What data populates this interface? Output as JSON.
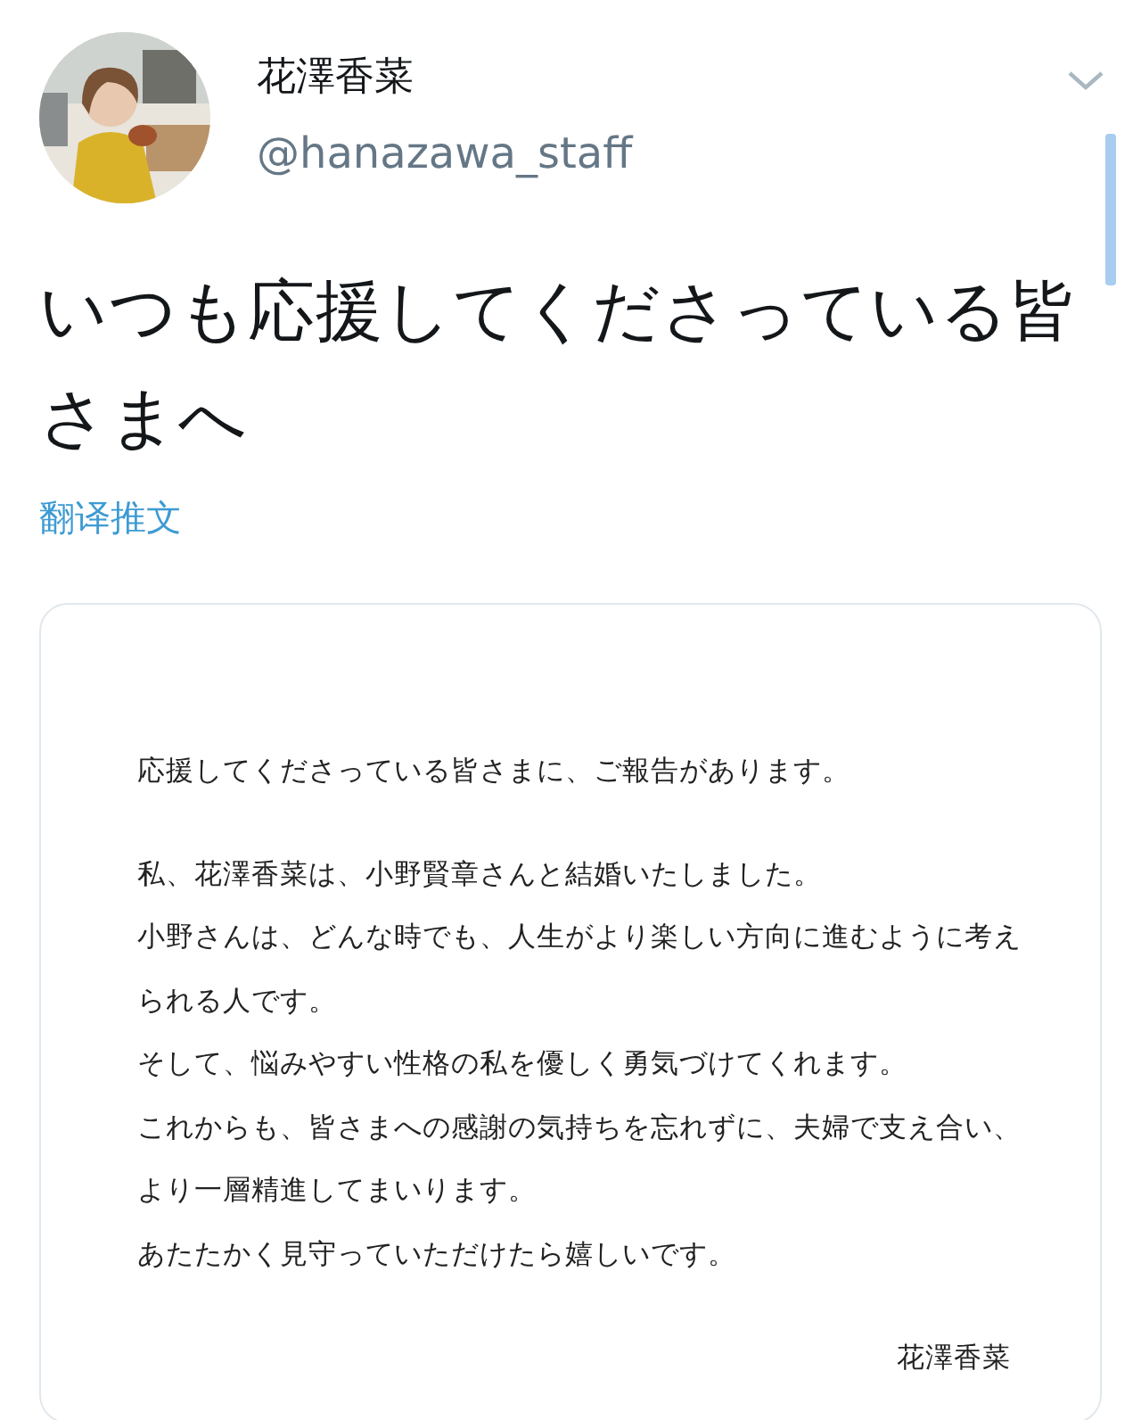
{
  "author": {
    "name": "花澤香菜",
    "handle": "@hanazawa_staff"
  },
  "tweet": {
    "text": "いつも応援してくださっている皆さまへ",
    "translate_link": "翻译推文"
  },
  "letter": {
    "paragraphs": [
      [
        "応援してくださっている皆さまに、ご報告があります。"
      ],
      [
        "私、花澤香菜は、小野賢章さんと結婚いたしました。",
        "小野さんは、どんな時でも、人生がより楽しい方向に進むように考え",
        "られる人です。",
        "そして、悩みやすい性格の私を優しく勇気づけてくれます。",
        "これからも、皆さまへの感謝の気持ちを忘れずに、夫婦で支え合い、",
        "より一層精進してまいります。",
        "あたたかく見守っていただけたら嬉しいです。"
      ]
    ],
    "signature": "花澤香菜"
  }
}
